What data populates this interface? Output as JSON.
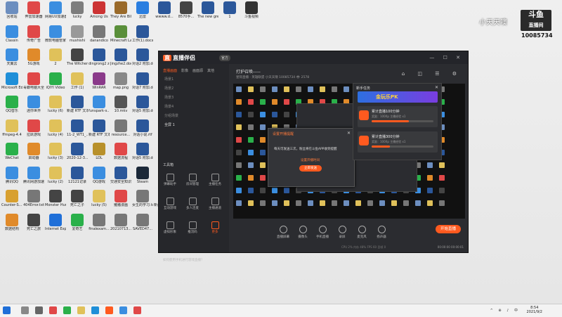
{
  "desktop_icons": [
    {
      "label": "回收站",
      "color": "#6c8ebf"
    },
    {
      "label": "奔雷加速器",
      "color": "#e04848"
    },
    {
      "label": "网易UU加速器",
      "color": "#3b8ee0"
    },
    {
      "label": "lucky",
      "color": "#7d7d7d"
    },
    {
      "label": "Among Us",
      "color": "#c33"
    },
    {
      "label": "They Are Billions",
      "color": "#9a6a2a"
    },
    {
      "label": "迅雷",
      "color": "#2a7ee0"
    },
    {
      "label": "wwww.d...",
      "color": "#2b579a"
    },
    {
      "label": "8570手...",
      "color": "#444"
    },
    {
      "label": "The new green rev...",
      "color": "#2b579a"
    },
    {
      "label": "1",
      "color": "#2b579a"
    },
    {
      "label": "斗鱼视频",
      "color": "#333"
    },
    {
      "label": "Classin",
      "color": "#3b8ee0"
    },
    {
      "label": "传奇广告",
      "color": "#e04848"
    },
    {
      "label": "微软电脑管家",
      "color": "#3b8ee0"
    },
    {
      "label": "mushishi",
      "color": "#999"
    },
    {
      "label": "danandico",
      "color": "#777"
    },
    {
      "label": "Minecraft Launcher",
      "color": "#5a8f3a"
    },
    {
      "label": "工作(1).docx",
      "color": "#2b579a"
    },
    {
      "label": "天翼云",
      "color": "#3b8ee0"
    },
    {
      "label": "5G游戏",
      "color": "#e08a2a"
    },
    {
      "label": "2",
      "color": "#e0c15a"
    },
    {
      "label": "The Witcher",
      "color": "#444"
    },
    {
      "label": "dingrong2 zoyo.docx",
      "color": "#2b579a"
    },
    {
      "label": "Jingzhe2.docx",
      "color": "#2b579a"
    },
    {
      "label": "对话2 附加.docx",
      "color": "#2b579a"
    },
    {
      "label": "Microsoft Edge",
      "color": "#1f8fd8"
    },
    {
      "label": "毒霸电脑大全",
      "color": "#e04848"
    },
    {
      "label": "iQIYI Video",
      "color": "#2ab04a"
    },
    {
      "label": "工作 (1)",
      "color": "#e0c15a"
    },
    {
      "label": "WinRAR",
      "color": "#8a3a8a"
    },
    {
      "label": "map.png",
      "color": "#888"
    },
    {
      "label": "对话7 附加.docx",
      "color": "#2b579a"
    },
    {
      "label": "QQ音乐",
      "color": "#2ab04a"
    },
    {
      "label": "迷你世界",
      "color": "#3b8ee0"
    },
    {
      "label": "lucky (6)",
      "color": "#e0c15a"
    },
    {
      "label": "新建 RTF 文本文档.rtf",
      "color": "#2b579a"
    },
    {
      "label": "funspark-s...",
      "color": "#3b8ee0"
    },
    {
      "label": "10.mkv",
      "color": "#555"
    },
    {
      "label": "对话5 附加.docx",
      "color": "#2b579a"
    },
    {
      "label": "ffmpeg-4.4",
      "color": "#e0c15a"
    },
    {
      "label": "拉跃游戏",
      "color": "#e04848"
    },
    {
      "label": "lucky (4)",
      "color": "#e0c15a"
    },
    {
      "label": "11-2_WT1_...",
      "color": "#2b579a"
    },
    {
      "label": "新建 RTF 文本文档.rtf",
      "color": "#2b579a"
    },
    {
      "label": "resource...",
      "color": "#777"
    },
    {
      "label": "对话小说.rtf",
      "color": "#2b579a"
    },
    {
      "label": "WeChat",
      "color": "#2ab04a"
    },
    {
      "label": "启动器",
      "color": "#e08a2a"
    },
    {
      "label": "lucky (3)",
      "color": "#e0c15a"
    },
    {
      "label": "2020-12-3...",
      "color": "#2b579a"
    },
    {
      "label": "LOL",
      "color": "#b8902a"
    },
    {
      "label": "数据流程",
      "color": "#e04848"
    },
    {
      "label": "对话5 附加.docx",
      "color": "#2b579a"
    },
    {
      "label": "腾讯QQ",
      "color": "#3b8ee0"
    },
    {
      "label": "腾讯网游加速器",
      "color": "#3b8ee0"
    },
    {
      "label": "lucky (2)",
      "color": "#e0c15a"
    },
    {
      "label": "12121记录",
      "color": "#2b579a"
    },
    {
      "label": "QQ游戏",
      "color": "#3b8ee0"
    },
    {
      "label": "交通安全知识.docx",
      "color": "#2b579a"
    },
    {
      "label": "Steam",
      "color": "#1b2838"
    },
    {
      "label": "Counter-S... Global Offe...",
      "color": "#d8a030"
    },
    {
      "label": "404Error.txt",
      "color": "#777"
    },
    {
      "label": "Monster Hunter...",
      "color": "#444"
    },
    {
      "label": "死亡之子",
      "color": "#444"
    },
    {
      "label": "lucky (5)",
      "color": "#e0c15a"
    },
    {
      "label": "猪猪漫画",
      "color": "#e04848"
    },
    {
      "label": "女生的学习.txt",
      "color": "#777"
    },
    {
      "label": "新建文本文件.txt",
      "color": "#777"
    },
    {
      "label": "新建文本文档.txt",
      "color": "#777"
    },
    {
      "label": "数据结构",
      "color": "#e08a2a"
    },
    {
      "label": "死亡之旅",
      "color": "#444"
    },
    {
      "label": "Internet Explorer",
      "color": "#1f6fd8"
    },
    {
      "label": "爱奇艺",
      "color": "#2ab04a"
    },
    {
      "label": "finalexam...",
      "color": "#777"
    },
    {
      "label": "20210713...",
      "color": "#777"
    },
    {
      "label": "SAVED47...",
      "color": "#777"
    },
    {
      "label": "开局图",
      "color": "#3b8ee0"
    },
    {
      "label": "头条直播伴侣",
      "color": "#e04848"
    },
    {
      "label": "新建伴侣说会...",
      "color": "#e04848"
    },
    {
      "label": "腾讯课堂的主",
      "color": "#3b8ee0"
    }
  ],
  "watermark": {
    "streamer": "小天天噢",
    "logo": "斗鱼",
    "logo_sub": "直播间",
    "room_id": "10085734"
  },
  "app": {
    "logo_badge": "直",
    "name": "直播伴侣",
    "version": "官方",
    "window_controls": "— ☐ ✕",
    "tabs": [
      "直播画面",
      "影像",
      "画面源",
      "其他"
    ],
    "scenes": [
      "场景1",
      "场景2",
      "场景3",
      "场景4",
      "分组场景"
    ],
    "current_scene": "全屏 1",
    "room_title": "打护召唤-----",
    "room_meta": "星际直播 · 英雄联盟  小天天噢  10085734  👁 2578",
    "toolbar_icons": "⌂ ◫ ☰ ⚙",
    "tools_title": "工具箱",
    "tools": [
      "弹幕助手",
      "房间管理",
      "主播任务",
      "互动游戏",
      "多人连麦",
      "主播通道",
      "虚拟形象",
      "推流码",
      "更多"
    ],
    "bottom_tip": "如何使用手机进行游戏直播？",
    "controls": [
      "直播屏幕",
      "摄像头",
      "手机直播",
      "录屏",
      "麦克风",
      "扬声器"
    ],
    "start_button": "开始直播",
    "stats": "CPU 2%  内存 48%  FPS 60  丢帧 0",
    "timer": "00:00:00  00:00:01"
  },
  "dialog": {
    "title": "设置开播提醒",
    "close": "✕",
    "message": "每天可发送三次，粉丝将在斗鱼APP收到提醒",
    "link": "设置开播时间",
    "button": "立即发送"
  },
  "task_panel": {
    "title": "新手任务",
    "close": "✕",
    "banner": "金玩乐PK",
    "items": [
      {
        "name": "累计直播100分钟",
        "desc": "奖励：100Xp 主播经验 x1",
        "progress": 0.6
      },
      {
        "name": "累计直播300分钟",
        "desc": "奖励：100Xp 主播经验 x1",
        "progress": 0.3
      }
    ]
  },
  "taskbar": {
    "tray": "^ ⊕ ♪ 中",
    "time": "8:54",
    "date": "2021/9/2"
  }
}
